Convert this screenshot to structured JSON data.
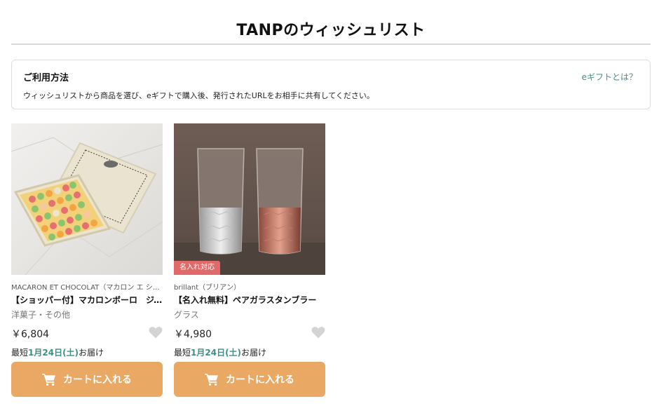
{
  "page": {
    "title": "TANPのウィッシュリスト"
  },
  "howto": {
    "heading": "ご利用方法",
    "link": "eギフトとは？",
    "text": "ウィッシュリストから商品を選び、eギフトで購入後、発行されたURLをお相手に共有してください。"
  },
  "colors": {
    "accent": "#3f8f85",
    "cart_button": "#e9a863",
    "badge": "#e06a6a",
    "heart": "#d4d4d4"
  },
  "products": [
    {
      "brand": "MACARON ET CHOCOLAT（マカロン エ ショコラ）",
      "name": "【ショッパー付】マカロンボーロ　ジュエリーボックス",
      "category": "洋菓子・その他",
      "price": "￥6,804",
      "delivery_prefix": "最短",
      "delivery_date": "1月24日(土)",
      "delivery_suffix": "お届け",
      "cart_label": "カートに入れる",
      "image_icon": "macaron-box-photo"
    },
    {
      "brand": "brillant（ブリアン）",
      "name": "【名入れ無料】ペアガラスタンブラー",
      "category": "グラス",
      "price": "￥4,980",
      "badge": "名入れ対応",
      "delivery_prefix": "最短",
      "delivery_date": "1月24日(土)",
      "delivery_suffix": "お届け",
      "cart_label": "カートに入れる",
      "image_icon": "pair-tumbler-photo"
    }
  ]
}
